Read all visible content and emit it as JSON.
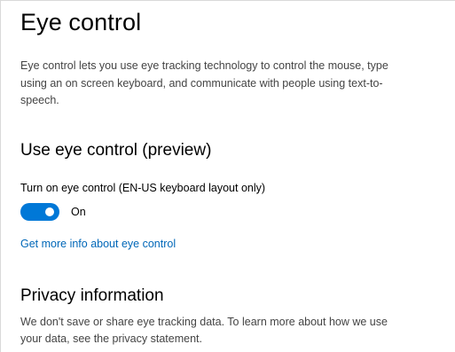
{
  "page": {
    "title": "Eye control",
    "description": "Eye control lets you use eye tracking technology to control the mouse, type using an on screen keyboard, and communicate with people using text-to-speech."
  },
  "use_eye_control": {
    "heading": "Use eye control (preview)",
    "toggle_label": "Turn on eye control (EN-US keyboard layout only)",
    "toggle_on": true,
    "toggle_state_text": "On",
    "more_info_link": "Get more info about eye control"
  },
  "privacy": {
    "heading": "Privacy information",
    "text": "We don't save or share eye tracking data. To learn more about how we use your data, see the privacy statement."
  },
  "colors": {
    "accent": "#0078d7",
    "link": "#0067b8",
    "secondary_text": "#444444"
  }
}
